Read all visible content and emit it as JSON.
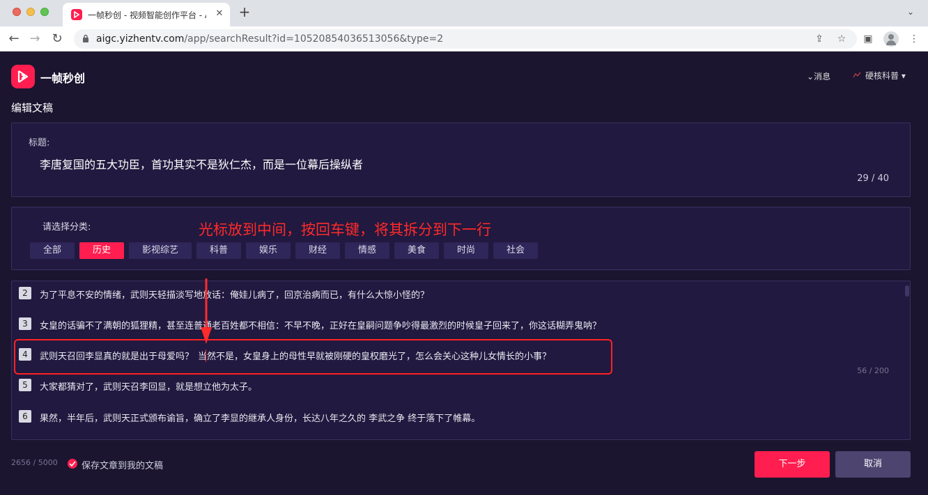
{
  "browser": {
    "tab_title": "一帧秒创 - 视频智能创作平台 - A",
    "tab_close": "✕",
    "new_tab": "+",
    "url_host": "aigc.yizhentv.com",
    "url_path": "/app/searchResult?id=10520854036513056&type=2",
    "icons": [
      "back-icon",
      "forward-icon",
      "reload-icon",
      "lock-icon",
      "share-icon",
      "star-icon",
      "sidebar-icon",
      "profile-icon",
      "menu-icon"
    ]
  },
  "header": {
    "brand": "一帧秒创",
    "messages": "消息",
    "user": "硬核科普",
    "accent_color": "#ff1e4f"
  },
  "page": {
    "title": "编辑文稿"
  },
  "title_section": {
    "label": "标题:",
    "value": "李唐复国的五大功臣，首功其实不是狄仁杰，而是一位幕后操纵者",
    "count": "29 / 40"
  },
  "category_section": {
    "label": "请选择分类:",
    "items": [
      {
        "label": "全部",
        "active": false
      },
      {
        "label": "历史",
        "active": true
      },
      {
        "label": "影视综艺",
        "active": false
      },
      {
        "label": "科普",
        "active": false
      },
      {
        "label": "娱乐",
        "active": false
      },
      {
        "label": "财经",
        "active": false
      },
      {
        "label": "情感",
        "active": false
      },
      {
        "label": "美食",
        "active": false
      },
      {
        "label": "时尚",
        "active": false
      },
      {
        "label": "社会",
        "active": false
      }
    ]
  },
  "annotation": {
    "text": "光标放到中间，按回车键，将其拆分到下一行",
    "color": "#ff2a2a"
  },
  "paragraphs": [
    {
      "num": "2",
      "text": "为了平息不安的情绪，武则天轻描淡写地放话：俺娃儿病了，回京治病而已，有什么大惊小怪的？"
    },
    {
      "num": "3",
      "text": "女皇的话骗不了满朝的狐狸精，甚至连普通老百姓都不相信：不早不晚，正好在皇嗣问题争吵得最激烈的时候皇子回来了，你这话糊弄鬼呐？"
    },
    {
      "num": "4",
      "text_before": "武则天召回李显真的就是出于母爱吗？",
      "text_after": "当然不是，女皇身上的母性早就被刚硬的皇权磨光了，怎么会关心这种儿女情长的小事？"
    },
    {
      "num": "5",
      "text": "大家都猜对了，武则天召李回显，就是想立他为太子。"
    },
    {
      "num": "6",
      "text": "果然，半年后，武则天正式颁布谕旨，确立了李显的继承人身份，长达八年之久的 李武之争 终于落下了帷幕。"
    }
  ],
  "paragraph_count": "56 / 200",
  "footer": {
    "word_count": "2656 / 5000",
    "save_label": "保存文章到我的文稿",
    "next_label": "下一步",
    "cancel_label": "取消"
  }
}
